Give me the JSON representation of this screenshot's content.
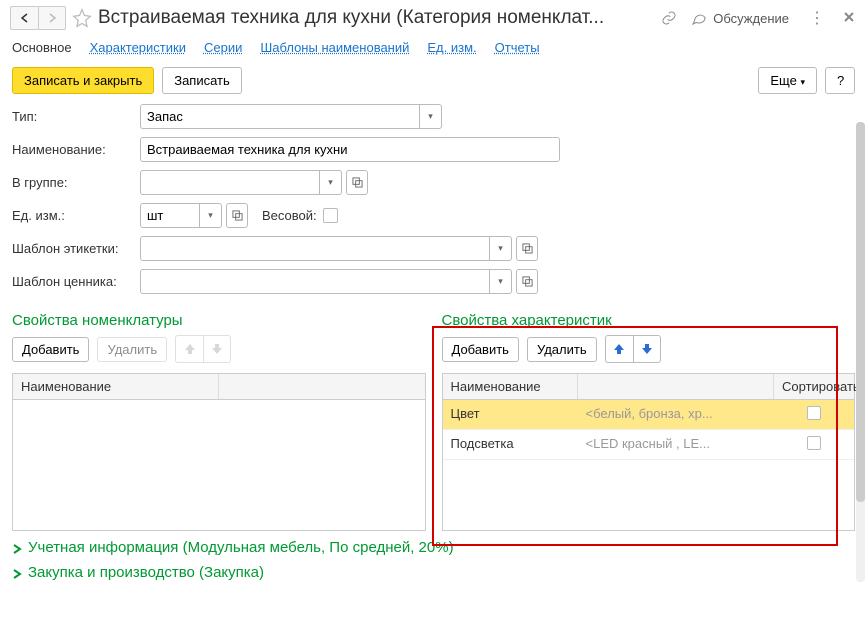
{
  "header": {
    "title": "Встраиваемая техника для кухни (Категория номенклат...",
    "discuss": "Обсуждение"
  },
  "tabs": {
    "main": "Основное",
    "chars": "Характеристики",
    "series": "Серии",
    "naming": "Шаблоны наименований",
    "units": "Ед. изм.",
    "reports": "Отчеты"
  },
  "toolbar": {
    "save_close": "Записать и закрыть",
    "save": "Записать",
    "more": "Еще",
    "help": "?"
  },
  "form": {
    "type_label": "Тип:",
    "type_value": "Запас",
    "name_label": "Наименование:",
    "name_value": "Встраиваемая техника для кухни",
    "group_label": "В группе:",
    "group_value": "",
    "unit_label": "Ед. изм.:",
    "unit_value": "шт",
    "weight_label": "Весовой:",
    "label_tpl_label": "Шаблон этикетки:",
    "label_tpl_value": "",
    "price_tpl_label": "Шаблон ценника:",
    "price_tpl_value": ""
  },
  "nom_props": {
    "title": "Свойства номенклатуры",
    "add": "Добавить",
    "delete": "Удалить",
    "col_name": "Наименование"
  },
  "char_props": {
    "title": "Свойства характеристик",
    "add": "Добавить",
    "delete": "Удалить",
    "col_name": "Наименование",
    "col_sort": "Сортировать",
    "rows": [
      {
        "name": "Цвет",
        "hint": "<белый, бронза, хр..."
      },
      {
        "name": "Подсветка",
        "hint": "<LED красный , LE..."
      }
    ]
  },
  "expanders": {
    "accounting": "Учетная информация (Модульная мебель, По средней, 20%)",
    "purchase": "Закупка и производство (Закупка)"
  }
}
